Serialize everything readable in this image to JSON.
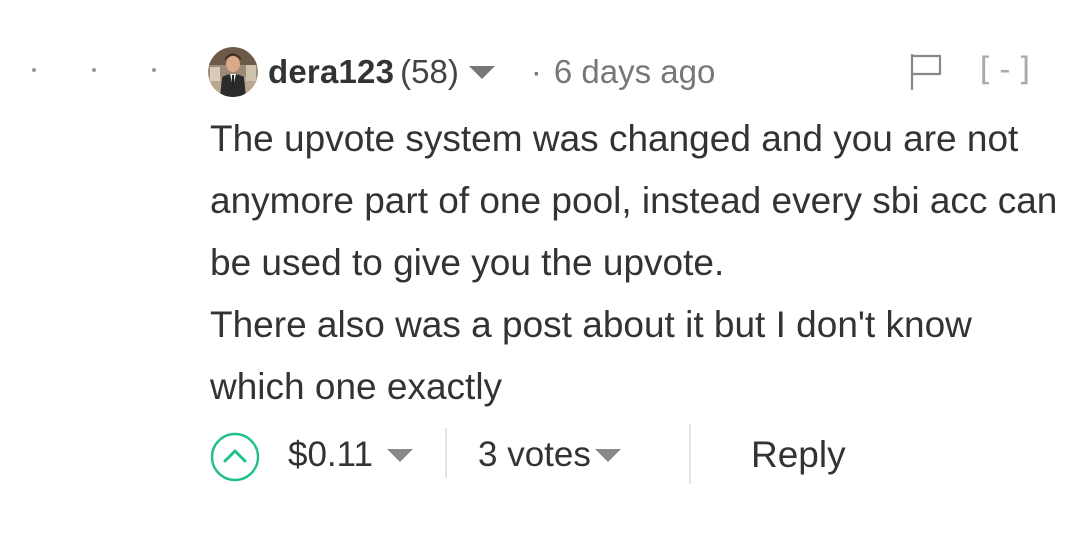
{
  "thread": {
    "indent_markers": [
      "·",
      "·",
      "·"
    ]
  },
  "comment": {
    "author": {
      "name": "dera123",
      "reputation": "(58)",
      "avatar_icon": "user-avatar"
    },
    "separator": "·",
    "timestamp": "6 days ago",
    "flag_icon": "flag-icon",
    "collapse_label": "[-]",
    "body": [
      "The upvote system was changed and you are not anymore part of one pool, instead every sbi acc can be used to give you the upvote.",
      "There also was a post about it but I don't know which one exactly"
    ]
  },
  "footer": {
    "upvote_icon": "upvote-chevron-icon",
    "payout": "$0.11",
    "votes": "3 votes",
    "reply_label": "Reply"
  },
  "colors": {
    "text": "#333333",
    "muted": "#777777",
    "upvote_accent": "#1fbf8f",
    "divider": "#e4e4e4"
  }
}
